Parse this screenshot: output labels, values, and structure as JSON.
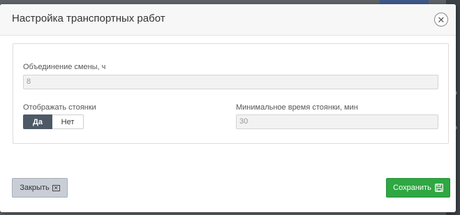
{
  "dialog": {
    "title": "Настройка транспортных работ",
    "close_icon": "close-icon"
  },
  "form": {
    "shift_merge": {
      "label": "Объединение смены, ч",
      "value": "8"
    },
    "show_stops": {
      "label": "Отображать стоянки",
      "options": [
        "Да",
        "Нет"
      ],
      "selected": "Да"
    },
    "min_stop_time": {
      "label": "Минимальное время стоянки, мин",
      "value": "30"
    }
  },
  "footer": {
    "close_label": "Закрыть",
    "save_label": "Сохранить"
  },
  "colors": {
    "save_button": "#2fa742",
    "close_button": "#c9ced6",
    "toggle_active": "#4d5966"
  }
}
